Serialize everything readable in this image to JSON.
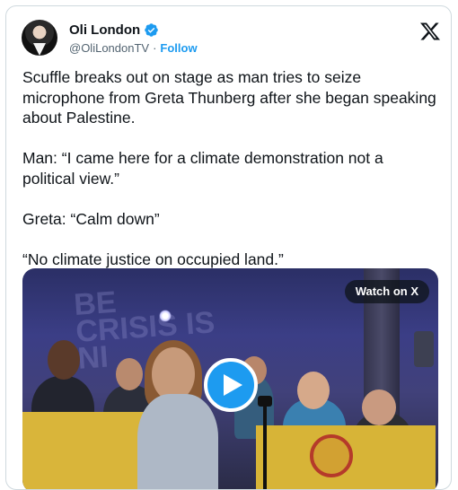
{
  "author": {
    "name": "Oli London",
    "handle": "@OliLondonTV",
    "separator": "·",
    "follow_label": "Follow"
  },
  "tweet": {
    "text": "Scuffle breaks out on stage as man tries to seize microphone from Greta Thunberg after she began speaking about Palestine.\n\nMan: “I came here for a climate demonstration not a political view.”\n\nGreta: “Calm down”\n\n“No climate justice on occupied land.”"
  },
  "media": {
    "watch_label": "Watch on X",
    "background_sign_text": "BE CRISIS IS NI"
  },
  "icons": {
    "verified": "verified-badge-icon",
    "logo": "x-logo-icon",
    "play": "play-icon"
  },
  "colors": {
    "accent": "#1d9bf0",
    "text": "#0f1419",
    "secondary": "#536471"
  }
}
